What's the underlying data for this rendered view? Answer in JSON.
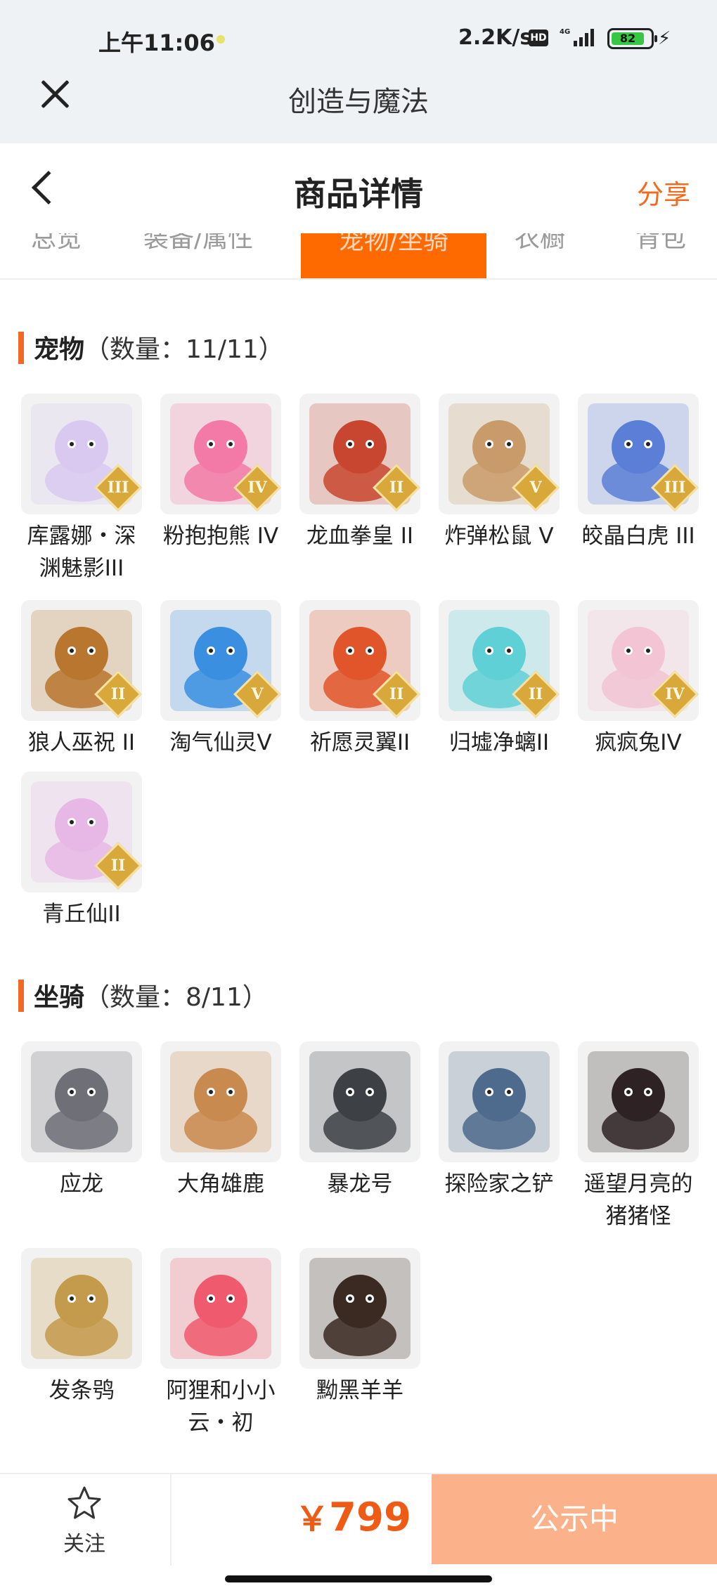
{
  "status_bar": {
    "time": "上午11:06",
    "network_speed": "2.2K/s",
    "hd": "HD",
    "battery": "82",
    "network_type": "4G"
  },
  "app_bar": {
    "title": "创造与魔法"
  },
  "header": {
    "title": "商品详情",
    "share": "分享"
  },
  "tabs": [
    {
      "label": "总览"
    },
    {
      "label": "装备/属性"
    },
    {
      "label": "宠物/坐骑"
    },
    {
      "label": "衣橱"
    },
    {
      "label": "背包"
    }
  ],
  "pets": {
    "title": "宠物",
    "count": "（数量：11/11）",
    "items": [
      {
        "name": "库露娜・深渊魅影III",
        "rank": "III",
        "color": "#d9c9f0"
      },
      {
        "name": "粉抱抱熊 IV",
        "rank": "IV",
        "color": "#f37aa6"
      },
      {
        "name": "龙血拳皇 II",
        "rank": "II",
        "color": "#c8462f"
      },
      {
        "name": "炸弹松鼠 V",
        "rank": "V",
        "color": "#c99b6a"
      },
      {
        "name": "皎晶白虎 III",
        "rank": "III",
        "color": "#5b7fd6"
      },
      {
        "name": "狼人巫祝 II",
        "rank": "II",
        "color": "#b9762e"
      },
      {
        "name": "淘气仙灵V",
        "rank": "V",
        "color": "#3a8fe0"
      },
      {
        "name": "祈愿灵翼II",
        "rank": "II",
        "color": "#e0562a"
      },
      {
        "name": "归墟净螭II",
        "rank": "II",
        "color": "#5fd0d6"
      },
      {
        "name": "疯疯兔IV",
        "rank": "IV",
        "color": "#f2c4d4"
      },
      {
        "name": "青丘仙II",
        "rank": "II",
        "color": "#e7b8e6"
      }
    ]
  },
  "mounts": {
    "title": "坐骑",
    "count": "（数量：8/11）",
    "items": [
      {
        "name": "应龙",
        "color": "#6f6f78"
      },
      {
        "name": "大角雄鹿",
        "color": "#c98a4f"
      },
      {
        "name": "暴龙号",
        "color": "#3d4044"
      },
      {
        "name": "探险家之铲",
        "color": "#4e6a8c"
      },
      {
        "name": "遥望月亮的猪猪怪",
        "color": "#2e2224"
      },
      {
        "name": "发条鸮",
        "color": "#c49a4c"
      },
      {
        "name": "阿狸和小小云・初",
        "color": "#f05a6e"
      },
      {
        "name": "黝黑羊羊",
        "color": "#3b2a22"
      }
    ]
  },
  "footer": {
    "follow": "关注",
    "price_symbol": "￥",
    "price": "799",
    "status": "公示中"
  }
}
